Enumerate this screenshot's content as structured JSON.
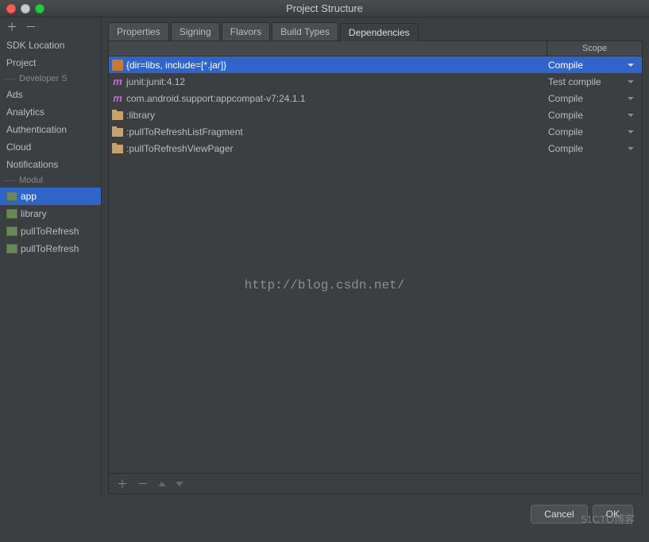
{
  "window": {
    "title": "Project Structure"
  },
  "sidebar": {
    "items": [
      {
        "label": "SDK Location"
      },
      {
        "label": "Project"
      }
    ],
    "sep1": "Developer S",
    "dev_items": [
      {
        "label": "Ads"
      },
      {
        "label": "Analytics"
      },
      {
        "label": "Authentication"
      },
      {
        "label": "Cloud"
      },
      {
        "label": "Notifications"
      }
    ],
    "sep2": "Modul",
    "modules": [
      {
        "label": "app",
        "selected": true
      },
      {
        "label": "library"
      },
      {
        "label": "pullToRefresh"
      },
      {
        "label": "pullToRefresh"
      }
    ]
  },
  "tabs": [
    {
      "label": "Properties"
    },
    {
      "label": "Signing"
    },
    {
      "label": "Flavors"
    },
    {
      "label": "Build Types"
    },
    {
      "label": "Dependencies",
      "active": true
    }
  ],
  "dep_header_scope": "Scope",
  "dependencies": [
    {
      "icon": "jar",
      "label": "{dir=libs, include=[*.jar]}",
      "scope": "Compile",
      "selected": true
    },
    {
      "icon": "m",
      "label": "junit:junit:4.12",
      "scope": "Test compile"
    },
    {
      "icon": "m",
      "label": "com.android.support:appcompat-v7:24.1.1",
      "scope": "Compile"
    },
    {
      "icon": "folder",
      "label": ":library",
      "scope": "Compile"
    },
    {
      "icon": "folder",
      "label": ":pullToRefreshListFragment",
      "scope": "Compile"
    },
    {
      "icon": "folder",
      "label": ":pullToRefreshViewPager",
      "scope": "Compile"
    }
  ],
  "footer": {
    "cancel": "Cancel",
    "ok": "OK"
  },
  "watermark": "http://blog.csdn.net/",
  "wm2": "51CTO博客"
}
